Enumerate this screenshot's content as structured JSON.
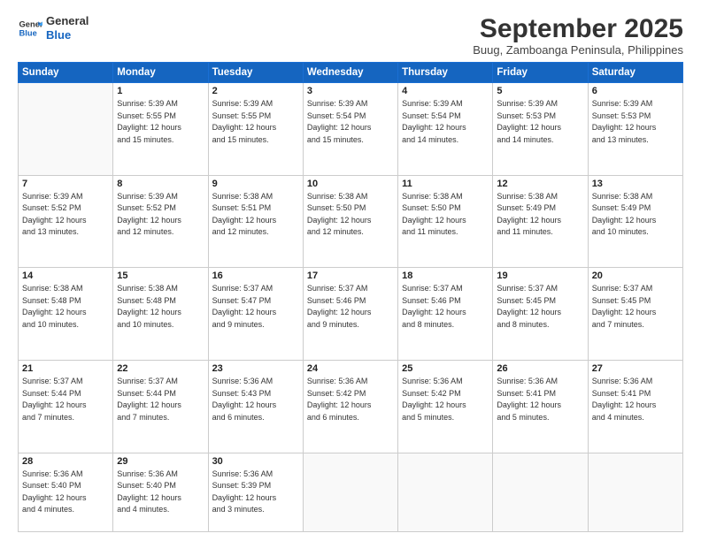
{
  "logo": {
    "line1": "General",
    "line2": "Blue"
  },
  "title": "September 2025",
  "subtitle": "Buug, Zamboanga Peninsula, Philippines",
  "weekdays": [
    "Sunday",
    "Monday",
    "Tuesday",
    "Wednesday",
    "Thursday",
    "Friday",
    "Saturday"
  ],
  "weeks": [
    [
      {
        "day": "",
        "info": ""
      },
      {
        "day": "1",
        "info": "Sunrise: 5:39 AM\nSunset: 5:55 PM\nDaylight: 12 hours\nand 15 minutes."
      },
      {
        "day": "2",
        "info": "Sunrise: 5:39 AM\nSunset: 5:55 PM\nDaylight: 12 hours\nand 15 minutes."
      },
      {
        "day": "3",
        "info": "Sunrise: 5:39 AM\nSunset: 5:54 PM\nDaylight: 12 hours\nand 15 minutes."
      },
      {
        "day": "4",
        "info": "Sunrise: 5:39 AM\nSunset: 5:54 PM\nDaylight: 12 hours\nand 14 minutes."
      },
      {
        "day": "5",
        "info": "Sunrise: 5:39 AM\nSunset: 5:53 PM\nDaylight: 12 hours\nand 14 minutes."
      },
      {
        "day": "6",
        "info": "Sunrise: 5:39 AM\nSunset: 5:53 PM\nDaylight: 12 hours\nand 13 minutes."
      }
    ],
    [
      {
        "day": "7",
        "info": "Sunrise: 5:39 AM\nSunset: 5:52 PM\nDaylight: 12 hours\nand 13 minutes."
      },
      {
        "day": "8",
        "info": "Sunrise: 5:39 AM\nSunset: 5:52 PM\nDaylight: 12 hours\nand 12 minutes."
      },
      {
        "day": "9",
        "info": "Sunrise: 5:38 AM\nSunset: 5:51 PM\nDaylight: 12 hours\nand 12 minutes."
      },
      {
        "day": "10",
        "info": "Sunrise: 5:38 AM\nSunset: 5:50 PM\nDaylight: 12 hours\nand 12 minutes."
      },
      {
        "day": "11",
        "info": "Sunrise: 5:38 AM\nSunset: 5:50 PM\nDaylight: 12 hours\nand 11 minutes."
      },
      {
        "day": "12",
        "info": "Sunrise: 5:38 AM\nSunset: 5:49 PM\nDaylight: 12 hours\nand 11 minutes."
      },
      {
        "day": "13",
        "info": "Sunrise: 5:38 AM\nSunset: 5:49 PM\nDaylight: 12 hours\nand 10 minutes."
      }
    ],
    [
      {
        "day": "14",
        "info": "Sunrise: 5:38 AM\nSunset: 5:48 PM\nDaylight: 12 hours\nand 10 minutes."
      },
      {
        "day": "15",
        "info": "Sunrise: 5:38 AM\nSunset: 5:48 PM\nDaylight: 12 hours\nand 10 minutes."
      },
      {
        "day": "16",
        "info": "Sunrise: 5:37 AM\nSunset: 5:47 PM\nDaylight: 12 hours\nand 9 minutes."
      },
      {
        "day": "17",
        "info": "Sunrise: 5:37 AM\nSunset: 5:46 PM\nDaylight: 12 hours\nand 9 minutes."
      },
      {
        "day": "18",
        "info": "Sunrise: 5:37 AM\nSunset: 5:46 PM\nDaylight: 12 hours\nand 8 minutes."
      },
      {
        "day": "19",
        "info": "Sunrise: 5:37 AM\nSunset: 5:45 PM\nDaylight: 12 hours\nand 8 minutes."
      },
      {
        "day": "20",
        "info": "Sunrise: 5:37 AM\nSunset: 5:45 PM\nDaylight: 12 hours\nand 7 minutes."
      }
    ],
    [
      {
        "day": "21",
        "info": "Sunrise: 5:37 AM\nSunset: 5:44 PM\nDaylight: 12 hours\nand 7 minutes."
      },
      {
        "day": "22",
        "info": "Sunrise: 5:37 AM\nSunset: 5:44 PM\nDaylight: 12 hours\nand 7 minutes."
      },
      {
        "day": "23",
        "info": "Sunrise: 5:36 AM\nSunset: 5:43 PM\nDaylight: 12 hours\nand 6 minutes."
      },
      {
        "day": "24",
        "info": "Sunrise: 5:36 AM\nSunset: 5:42 PM\nDaylight: 12 hours\nand 6 minutes."
      },
      {
        "day": "25",
        "info": "Sunrise: 5:36 AM\nSunset: 5:42 PM\nDaylight: 12 hours\nand 5 minutes."
      },
      {
        "day": "26",
        "info": "Sunrise: 5:36 AM\nSunset: 5:41 PM\nDaylight: 12 hours\nand 5 minutes."
      },
      {
        "day": "27",
        "info": "Sunrise: 5:36 AM\nSunset: 5:41 PM\nDaylight: 12 hours\nand 4 minutes."
      }
    ],
    [
      {
        "day": "28",
        "info": "Sunrise: 5:36 AM\nSunset: 5:40 PM\nDaylight: 12 hours\nand 4 minutes."
      },
      {
        "day": "29",
        "info": "Sunrise: 5:36 AM\nSunset: 5:40 PM\nDaylight: 12 hours\nand 4 minutes."
      },
      {
        "day": "30",
        "info": "Sunrise: 5:36 AM\nSunset: 5:39 PM\nDaylight: 12 hours\nand 3 minutes."
      },
      {
        "day": "",
        "info": ""
      },
      {
        "day": "",
        "info": ""
      },
      {
        "day": "",
        "info": ""
      },
      {
        "day": "",
        "info": ""
      }
    ]
  ]
}
